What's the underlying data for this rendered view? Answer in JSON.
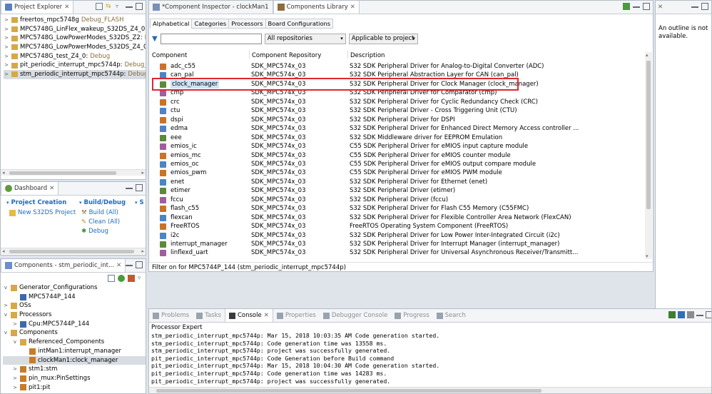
{
  "colors": {
    "accent": "#1e6bbf",
    "highlight": "#e0272e",
    "selection": "#d8dde3",
    "drag": "#9c9c9c"
  },
  "project_explorer": {
    "tab": "Project Explorer",
    "items": [
      {
        "name": "freertos_mpc5748g",
        "dec": " Debug_FLASH"
      },
      {
        "name": "MPC5748G_LinFlex_wakeup_S32DS_Z4_0:",
        "dec": " Debu"
      },
      {
        "name": "MPC5748G_LowPowerModes_S32DS_Z2:",
        "dec": " Deb"
      },
      {
        "name": "MPC5748G_LowPowerModes_S32DS_Z4_0:",
        "dec": " Deb"
      },
      {
        "name": "MPC5748G_test_Z4_0:",
        "dec": " Debug"
      },
      {
        "name": "pit_periodic_interrupt_mpc5744p:",
        "dec": " Debug_FLAS"
      },
      {
        "name": "stm_periodic_interrupt_mpc5744p:",
        "dec": " Debug_FLA"
      }
    ]
  },
  "dashboard": {
    "tab": "Dashboard",
    "project_creation": "Project Creation",
    "new_project": "New S32DS Project",
    "build_debug": "Build/Debug",
    "build": "Build  (All)",
    "clean": "Clean  (All)",
    "debug": "Debug",
    "third": "S"
  },
  "components_view": {
    "tab": "Components - stm_periodic_int...",
    "tree": [
      {
        "label": "Generator_Configurations",
        "level": 0,
        "arrow": "v"
      },
      {
        "label": "MPC5744P_144",
        "level": 1,
        "arrow": ""
      },
      {
        "label": "OSs",
        "level": 0,
        "arrow": ">"
      },
      {
        "label": "Processors",
        "level": 0,
        "arrow": "v"
      },
      {
        "label": "Cpu:MPC5744P_144",
        "level": 1,
        "arrow": ">"
      },
      {
        "label": "Components",
        "level": 0,
        "arrow": "v"
      },
      {
        "label": "Referenced_Components",
        "level": 1,
        "arrow": "v"
      },
      {
        "label": "intMan1:interrupt_manager",
        "level": 2,
        "arrow": ""
      },
      {
        "label": "clockMan1:clock_manager",
        "level": 2,
        "arrow": ""
      },
      {
        "label": "stm1:stm",
        "level": 1,
        "arrow": ">"
      },
      {
        "label": "pin_mux:PinSettings",
        "level": 1,
        "arrow": ">"
      },
      {
        "label": "pit1:pit",
        "level": 1,
        "arrow": ">"
      }
    ]
  },
  "editor_tabs": {
    "inspector": "*Component Inspector - clockMan1",
    "library": "Components Library"
  },
  "library": {
    "subtabs": [
      "Alphabetical",
      "Categories",
      "Processors",
      "Board Configurations"
    ],
    "filter_value": "",
    "repo_select": "All repositories",
    "scope_select": "Applicable to project",
    "headers": {
      "component": "Component",
      "repo": "Component Repository",
      "desc": "Description"
    },
    "rows": [
      {
        "name": "adc_c55",
        "repo": "SDK_MPC574x_03",
        "desc": "S32 SDK Peripheral Driver for Analog-to-Digital Converter (ADC)"
      },
      {
        "name": "can_pal",
        "repo": "SDK_MPC574x_03",
        "desc": "S32 SDK Peripheral Abstraction Layer for CAN (can_pal)"
      },
      {
        "name": "clock_manager",
        "repo": "SDK_MPC574x_03",
        "desc": "S32 SDK Peripheral Driver for Clock Manager (clock_manager)"
      },
      {
        "name": "cmp",
        "repo": "SDK_MPC574x_03",
        "desc": "S32 SDK Peripheral Driver for Comparator (cmp)"
      },
      {
        "name": "crc",
        "repo": "SDK_MPC574x_03",
        "desc": "S32 SDK Peripheral Driver for Cyclic Redundancy Check (CRC)"
      },
      {
        "name": "ctu",
        "repo": "SDK_MPC574x_03",
        "desc": "S32 SDK Peripheral Driver - Cross Triggering Unit (CTU)"
      },
      {
        "name": "dspi",
        "repo": "SDK_MPC574x_03",
        "desc": "S32 SDK Peripheral Driver for DSPI"
      },
      {
        "name": "edma",
        "repo": "SDK_MPC574x_03",
        "desc": "S32 SDK Peripheral Driver for Enhanced Direct Memory Access controller ..."
      },
      {
        "name": "eee",
        "repo": "SDK_MPC574x_03",
        "desc": "S32 SDK Middleware driver for EEPROM Emulation"
      },
      {
        "name": "emios_ic",
        "repo": "SDK_MPC574x_03",
        "desc": "C55 SDK Peripheral Driver for eMIOS input capture module"
      },
      {
        "name": "emios_mc",
        "repo": "SDK_MPC574x_03",
        "desc": "C55 SDK Peripheral Driver for eMIOS counter module"
      },
      {
        "name": "emios_oc",
        "repo": "SDK_MPC574x_03",
        "desc": "C55 SDK Peripheral Driver for eMIOS output compare module"
      },
      {
        "name": "emios_pwm",
        "repo": "SDK_MPC574x_03",
        "desc": "C55 SDK Peripheral Driver for eMIOS PWM module"
      },
      {
        "name": "enet",
        "repo": "SDK_MPC574x_03",
        "desc": "S32 SDK Peripheral Driver for Ethernet (enet)"
      },
      {
        "name": "etimer",
        "repo": "SDK_MPC574x_03",
        "desc": "S32 SDK Peripheral Driver (etimer)"
      },
      {
        "name": "fccu",
        "repo": "SDK_MPC574x_03",
        "desc": "S32 SDK Peripheral Driver (fccu)"
      },
      {
        "name": "flash_c55",
        "repo": "SDK_MPC574x_03",
        "desc": "S32 SDK Peripheral Driver for Flash C55 Memory (C55FMC)"
      },
      {
        "name": "flexcan",
        "repo": "SDK_MPC574x_03",
        "desc": "S32 SDK Peripheral Driver for Flexible Controller Area Network (FlexCAN)"
      },
      {
        "name": "FreeRTOS",
        "repo": "SDK_MPC574x_03",
        "desc": "FreeRTOS Operating System Component (FreeRTOS)"
      },
      {
        "name": "i2c",
        "repo": "SDK_MPC574x_03",
        "desc": "S32 SDK Peripheral Driver for Low Power Inter-Integrated Circuit (i2c)"
      },
      {
        "name": "interrupt_manager",
        "repo": "SDK_MPC574x_03",
        "desc": "S32 SDK Peripheral Driver for Interrupt Manager (interrupt_manager)"
      },
      {
        "name": "linflexd_uart",
        "repo": "SDK_MPC574x_03",
        "desc": "S32 SDK Peripheral Driver for Universal Asynchronous Receiver/Transmitt..."
      }
    ],
    "footer": "Filter on for MPC5744P_144 (stm_periodic_interrupt_mpc5744p)"
  },
  "outline": {
    "message": "An outline is not available."
  },
  "bottom": {
    "tabs": [
      "Problems",
      "Tasks",
      "Console",
      "Properties",
      "Debugger Console",
      "Progress",
      "Search"
    ],
    "title": "Processor Expert",
    "lines": [
      "stm_periodic_interrupt_mpc5744p: Mar 15, 2018 10:03:35 AM Code generation started.",
      "stm_periodic_interrupt_mpc5744p: Code generation time was 13558 ms.",
      "stm_periodic_interrupt_mpc5744p: project was successfully generated.",
      "pit_periodic_interrupt_mpc5744p: Code Generation before Build command",
      "pit_periodic_interrupt_mpc5744p: Mar 15, 2018 10:04:30 AM Code generation started.",
      "pit_periodic_interrupt_mpc5744p: Code generation time was 14283 ms.",
      "pit_periodic_interrupt_mpc5744p: project was successfully generated."
    ]
  }
}
